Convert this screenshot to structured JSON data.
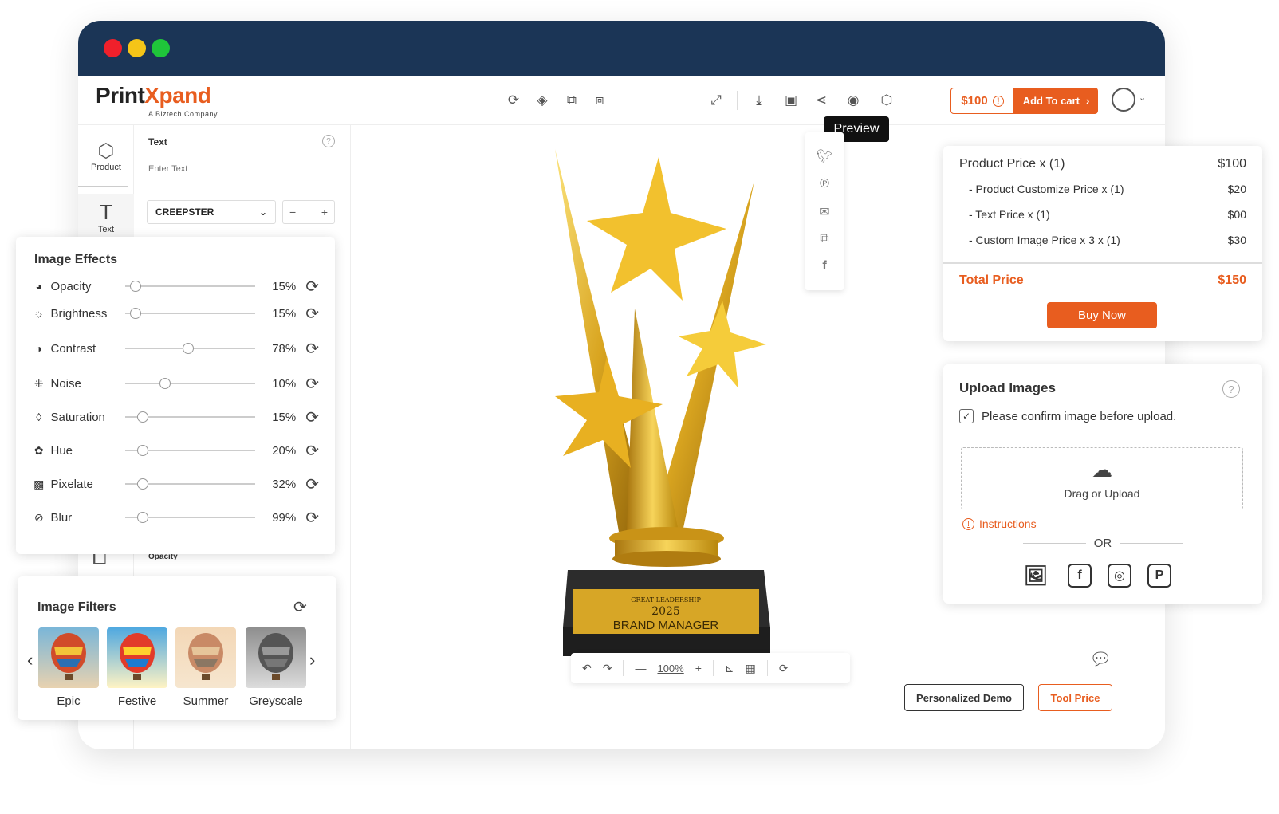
{
  "app": {
    "logo_main": "Print",
    "logo_x": "X",
    "logo_pand": "pand",
    "logo_sub": "A Biztech Company"
  },
  "header": {
    "price": "$100",
    "add_to_cart": "Add To cart",
    "tooltip": "Preview"
  },
  "left_rail": {
    "product_label": "Product",
    "text_label": "Text"
  },
  "text_panel": {
    "title": "Text",
    "input_placeholder": "Enter Text",
    "font_name": "CREEPSTER",
    "opacity_label": "Opacity"
  },
  "image_effects": {
    "title": "Image Effects",
    "items": [
      {
        "label": "Opacity",
        "value": "15%",
        "level": 0.05
      },
      {
        "label": "Brightness",
        "value": "15%",
        "level": 0.05
      },
      {
        "label": "Contrast",
        "value": "78%",
        "level": 0.44
      },
      {
        "label": "Noise",
        "value": "10%",
        "level": 0.27
      },
      {
        "label": "Saturation",
        "value": "15%",
        "level": 0.1
      },
      {
        "label": "Hue",
        "value": "20%",
        "level": 0.1
      },
      {
        "label": "Pixelate",
        "value": "32%",
        "level": 0.1
      },
      {
        "label": "Blur",
        "value": "99%",
        "level": 0.1
      }
    ]
  },
  "image_filters": {
    "title": "Image Filters",
    "items": [
      {
        "label": "Epic"
      },
      {
        "label": "Festive"
      },
      {
        "label": "Summer"
      },
      {
        "label": "Greyscale"
      }
    ]
  },
  "trophy": {
    "plate_line1": "GREAT LEADERSHIP",
    "plate_line2": "2025",
    "plate_line3": "BRAND MANAGER"
  },
  "canvas_toolbar": {
    "zoom": "100%"
  },
  "price_summary": {
    "product_label": "Product Price  x  (1)",
    "product_value": "$100",
    "customize_label": "- Product Customize Price  x  (1)",
    "customize_value": "$20",
    "text_label": "- Text Price x (1)",
    "text_value": "$00",
    "image_label": "- Custom Image Price x 3 x  (1)",
    "image_value": "$30",
    "total_label": "Total Price",
    "total_value": "$150",
    "buy_now": "Buy Now"
  },
  "upload": {
    "title": "Upload Images",
    "confirm": "Please confirm image before upload.",
    "drag": "Drag or Upload",
    "instructions": "Instructions",
    "or": "OR"
  },
  "footer": {
    "demo": "Personalized Demo",
    "tool_price": "Tool Price"
  },
  "colors": {
    "accent": "#e85d1f",
    "titlebar": "#1b3556"
  }
}
